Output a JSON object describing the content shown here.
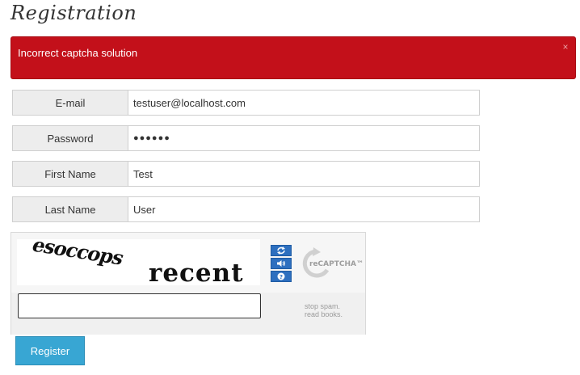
{
  "page": {
    "title": "Registration"
  },
  "alert": {
    "message": "Incorrect captcha solution",
    "close_glyph": "×",
    "color": "#c3101a"
  },
  "form": {
    "fields": [
      {
        "label": "E-mail",
        "value": "testuser@localhost.com",
        "type": "email"
      },
      {
        "label": "Password",
        "value": "●●●●●●",
        "type": "password"
      },
      {
        "label": "First Name",
        "value": "Test",
        "type": "text"
      },
      {
        "label": "Last Name",
        "value": "User",
        "type": "text"
      }
    ],
    "register_label": "Register",
    "register_color": "#38a6d3"
  },
  "captcha": {
    "image_words": [
      "esoccops",
      "recent"
    ],
    "brand_label": "reCAPTCHA™",
    "tagline_line1": "stop spam.",
    "tagline_line2": "read books.",
    "answer_value": "",
    "controls": [
      "refresh-icon",
      "audio-icon",
      "help-icon"
    ]
  }
}
